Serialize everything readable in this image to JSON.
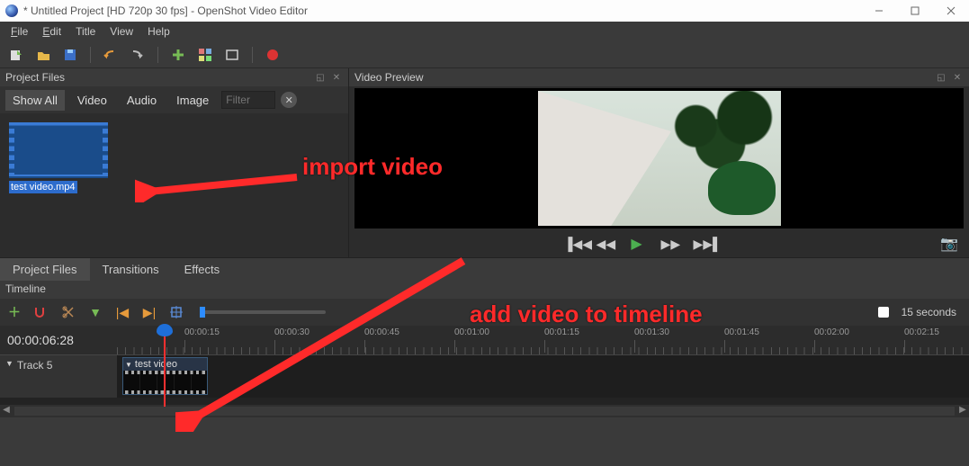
{
  "window": {
    "title": "* Untitled Project [HD 720p 30 fps] - OpenShot Video Editor"
  },
  "menubar": [
    "File",
    "Edit",
    "Title",
    "View",
    "Help"
  ],
  "panels": {
    "project_files": {
      "title": "Project Files",
      "tabs": {
        "show_all": "Show All",
        "video": "Video",
        "audio": "Audio",
        "image": "Image"
      },
      "filter_placeholder": "Filter",
      "files": [
        {
          "name": "test video.mp4"
        }
      ]
    },
    "video_preview": {
      "title": "Video Preview"
    }
  },
  "left_tabs": {
    "project_files": "Project Files",
    "transitions": "Transitions",
    "effects": "Effects"
  },
  "timeline": {
    "title": "Timeline",
    "timecode": "00:00:06:28",
    "zoom_label": "15 seconds",
    "ticks": [
      "00:00:15",
      "00:00:30",
      "00:00:45",
      "00:01:00",
      "00:01:15",
      "00:01:30",
      "00:01:45",
      "00:02:00",
      "00:02:15"
    ],
    "track": {
      "name": "Track 5",
      "clip_name": "test video"
    }
  },
  "annotations": {
    "import": "import  video",
    "add": "add video to timeline"
  }
}
